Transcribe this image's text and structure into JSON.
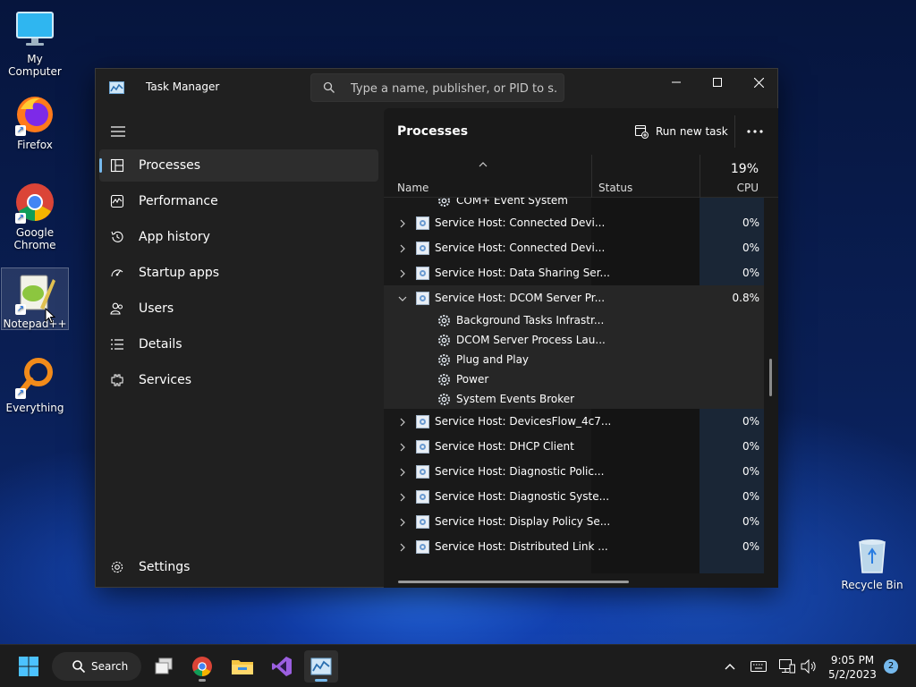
{
  "desktop": {
    "icons": [
      {
        "label": "My Computer",
        "icon": "monitor-icon"
      },
      {
        "label": "Firefox",
        "icon": "firefox-icon"
      },
      {
        "label": "Google Chrome",
        "icon": "chrome-icon"
      },
      {
        "label": "Notepad++",
        "icon": "notepadpp-icon"
      },
      {
        "label": "Everything",
        "icon": "everything-icon"
      },
      {
        "label": "Recycle Bin",
        "icon": "recycle-bin-icon"
      }
    ]
  },
  "window": {
    "title": "Task Manager",
    "search_placeholder": "Type a name, publisher, or PID to s..."
  },
  "sidebar": {
    "items": [
      {
        "label": "Processes",
        "icon": "processes-icon",
        "active": true
      },
      {
        "label": "Performance",
        "icon": "performance-icon"
      },
      {
        "label": "App history",
        "icon": "history-icon"
      },
      {
        "label": "Startup apps",
        "icon": "startup-icon"
      },
      {
        "label": "Users",
        "icon": "users-icon"
      },
      {
        "label": "Details",
        "icon": "details-icon"
      },
      {
        "label": "Services",
        "icon": "services-icon"
      }
    ],
    "settings_label": "Settings"
  },
  "content": {
    "title": "Processes",
    "run_new_task": "Run new task",
    "columns": {
      "name": "Name",
      "status": "Status",
      "cpu_percent": "19%",
      "cpu": "CPU"
    },
    "rows": [
      {
        "name": "COM+ Event System",
        "cpu": "",
        "child": true
      },
      {
        "name": "Service Host: Connected Devi...",
        "cpu": "0%"
      },
      {
        "name": "Service Host: Connected Devi...",
        "cpu": "0%"
      },
      {
        "name": "Service Host: Data Sharing Ser...",
        "cpu": "0%"
      },
      {
        "name": "Service Host: DCOM Server Pr...",
        "cpu": "0.8%",
        "expanded": true
      },
      {
        "name": "Background Tasks Infrastr...",
        "cpu": "",
        "child": true
      },
      {
        "name": "DCOM Server Process Lau...",
        "cpu": "",
        "child": true
      },
      {
        "name": "Plug and Play",
        "cpu": "",
        "child": true
      },
      {
        "name": "Power",
        "cpu": "",
        "child": true
      },
      {
        "name": "System Events Broker",
        "cpu": "",
        "child": true
      },
      {
        "name": "Service Host: DevicesFlow_4c7...",
        "cpu": "0%"
      },
      {
        "name": "Service Host: DHCP Client",
        "cpu": "0%"
      },
      {
        "name": "Service Host: Diagnostic Polic...",
        "cpu": "0%"
      },
      {
        "name": "Service Host: Diagnostic Syste...",
        "cpu": "0%"
      },
      {
        "name": "Service Host: Display Policy Se...",
        "cpu": "0%"
      },
      {
        "name": "Service Host: Distributed Link ...",
        "cpu": "0%"
      }
    ]
  },
  "taskbar": {
    "search_label": "Search",
    "time": "9:05 PM",
    "date": "5/2/2023",
    "notification_count": "2"
  }
}
